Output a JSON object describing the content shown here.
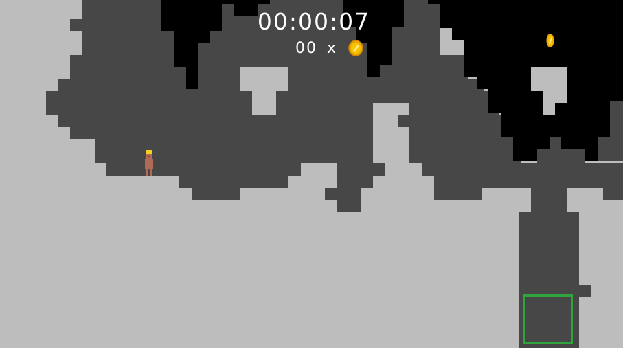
{
  "hud": {
    "timer": "00:00:07",
    "coin_count": "00",
    "coin_multiplier": "x",
    "coin_icon": "gold-coin-icon"
  },
  "level": {
    "player": "player-character-yellow-hat",
    "collectible": "gold-coin-icon",
    "exit": "green-exit-box"
  },
  "colors": {
    "rock": "#bdbdbd",
    "cave": "#474747",
    "dark": "#000000",
    "player_body": "#b06a55",
    "player_hat": "#f4d020",
    "coin": "#f0a800",
    "exit_border": "#2fa43b",
    "hud_text": "#ffffff"
  }
}
